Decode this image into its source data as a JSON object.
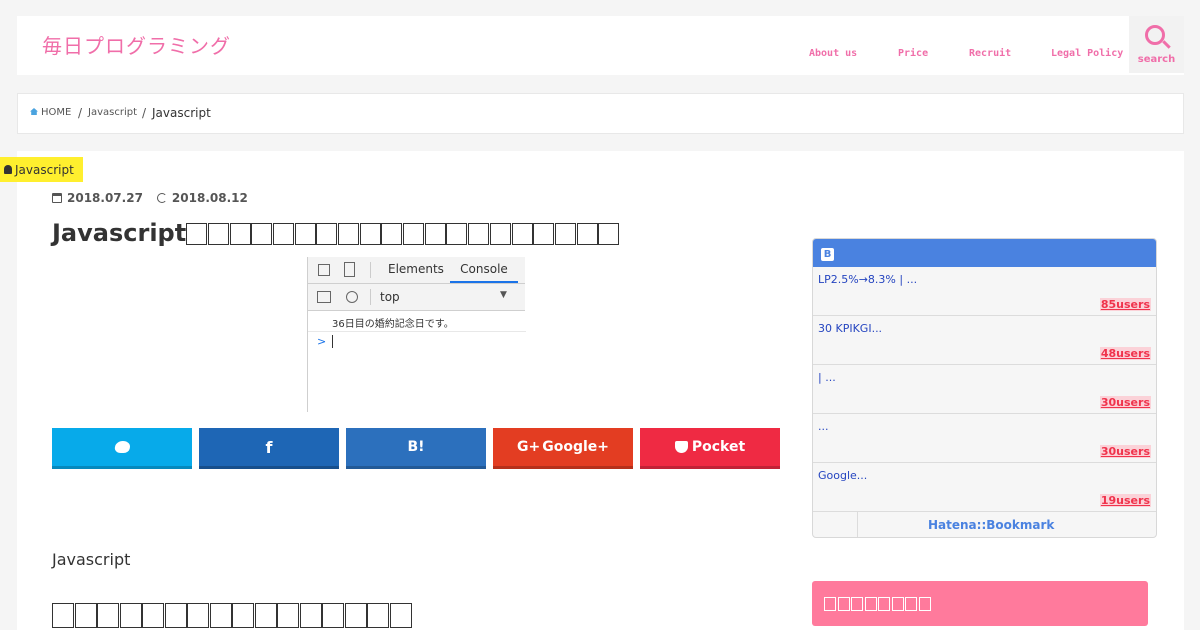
{
  "header": {
    "logo": "毎日プログラミング",
    "nav": [
      "About us",
      "Price",
      "Recruit",
      "Legal Policy"
    ],
    "search_label": "search"
  },
  "breadcrumb": {
    "home": "HOME",
    "category": "Javascript",
    "current": "Javascript",
    "separator": "/"
  },
  "article": {
    "category_badge": "Javascript",
    "published": "2018.07.27",
    "updated": "2018.08.12",
    "title": "Javascript",
    "section_label": "Javascript"
  },
  "devtools": {
    "tabs": [
      "Elements",
      "Console"
    ],
    "active_tab": "Console",
    "context": "top",
    "message": "36日目の婚約記念日です。",
    "prompt": ">"
  },
  "share": {
    "twitter": "",
    "facebook": "f",
    "hatena": "B!",
    "google": "Google+",
    "pocket": "Pocket",
    "colors": {
      "twitter": "#07aaea",
      "facebook": "#1e66b5",
      "hatena": "#2c70bd",
      "google": "#e33d22",
      "pocket": "#ef2a43"
    }
  },
  "hatena_widget": {
    "icon": "B",
    "entries": [
      {
        "title": "LP2.5%→8.3% | ...",
        "users": "85users"
      },
      {
        "title": "30 KPIKGI...",
        "users": "48users"
      },
      {
        "title": " | ...",
        "users": "30users"
      },
      {
        "title": " ...",
        "users": "30users"
      },
      {
        "title": "Google...",
        "users": "19users"
      }
    ],
    "footer": "Hatena::Bookmark"
  },
  "colors": {
    "accent_pink": "#f06ea9",
    "badge_yellow": "#ffef2e",
    "hatena_blue": "#4a82e0",
    "sidebar_pink": "#ff7a9c"
  }
}
